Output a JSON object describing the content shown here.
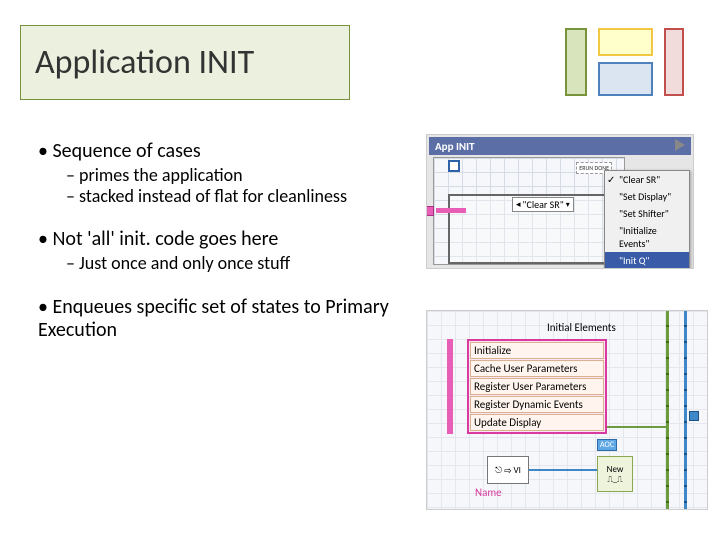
{
  "title": "Application INIT",
  "bullets": [
    {
      "text": "Sequence of cases",
      "subs": [
        "primes the application",
        "stacked instead of flat for cleanliness"
      ]
    },
    {
      "text": "Not 'all' init. code goes here",
      "subs": [
        "Just once and only once stuff"
      ]
    },
    {
      "text": "Enqueues specific set of states to Primary Execution",
      "subs": []
    }
  ],
  "fig1": {
    "header": "App INIT",
    "case_label": "\"Clear SR\"",
    "erun": "ERUN DONE",
    "menu": [
      "\"Clear SR\"",
      "\"Set Display\"",
      "\"Set Shifter\"",
      "\"Initialize Events\"",
      "\"Init Q\""
    ],
    "menu_checked": 0,
    "menu_selected": 4
  },
  "fig2": {
    "title": "Initial Elements",
    "items": [
      "Initialize",
      "Cache User Parameters",
      "Register User Parameters",
      "Register Dynamic Events",
      "Update Display"
    ],
    "node": "⎋ ⇨ VI",
    "name": "Name",
    "new": "New",
    "aoc": "AOC"
  }
}
